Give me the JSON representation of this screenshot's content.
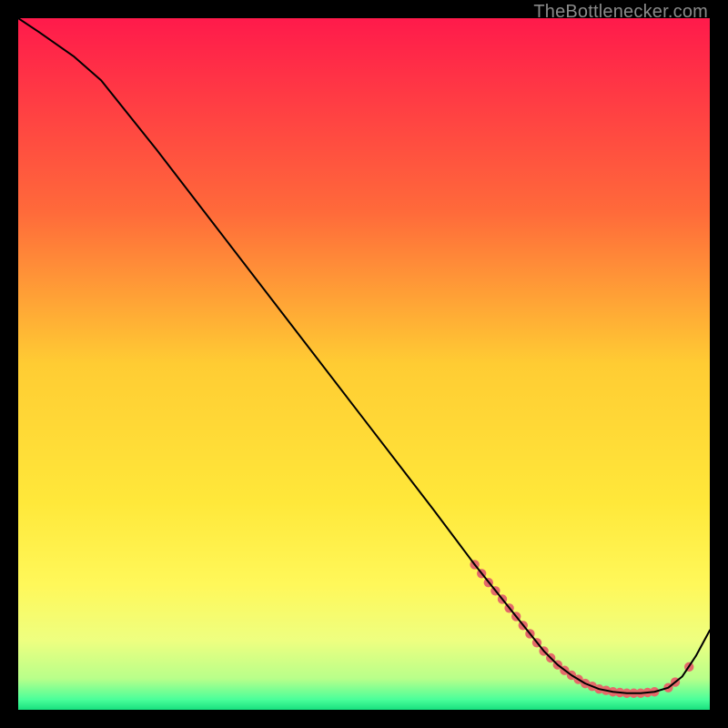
{
  "watermark": "TheBottlenecker.com",
  "chart_data": {
    "type": "line",
    "title": "",
    "xlabel": "",
    "ylabel": "",
    "xlim": [
      0,
      100
    ],
    "ylim": [
      0,
      100
    ],
    "background_gradient": {
      "stops": [
        {
          "offset": 0,
          "color": "#ff1a4b"
        },
        {
          "offset": 0.28,
          "color": "#ff6a3a"
        },
        {
          "offset": 0.5,
          "color": "#ffcc33"
        },
        {
          "offset": 0.7,
          "color": "#ffe83a"
        },
        {
          "offset": 0.82,
          "color": "#fff85a"
        },
        {
          "offset": 0.9,
          "color": "#eeff80"
        },
        {
          "offset": 0.955,
          "color": "#b8ff8a"
        },
        {
          "offset": 0.985,
          "color": "#4bff9a"
        },
        {
          "offset": 1.0,
          "color": "#18e07e"
        }
      ]
    },
    "series": [
      {
        "name": "bottleneck-curve",
        "color": "#000000",
        "stroke_width": 2,
        "x": [
          0,
          3,
          8,
          12,
          20,
          30,
          40,
          50,
          60,
          66,
          70,
          72,
          74,
          76,
          78,
          80,
          82,
          84,
          86,
          88,
          90,
          92,
          94,
          96,
          98,
          100
        ],
        "y": [
          100,
          98,
          94.5,
          91,
          81,
          68,
          55,
          42,
          29,
          21,
          16,
          13.5,
          11,
          8.5,
          6.5,
          5,
          3.8,
          3,
          2.6,
          2.4,
          2.4,
          2.6,
          3.2,
          4.8,
          7.8,
          11.5
        ]
      }
    ],
    "markers": {
      "name": "highlight-dots",
      "color": "#e46a6a",
      "radius": 5.2,
      "x": [
        66,
        67,
        68,
        69,
        70,
        71,
        72,
        73,
        74,
        75,
        76,
        77,
        78,
        79,
        80,
        81,
        82,
        83,
        84,
        85,
        86,
        87,
        88,
        89,
        90,
        91,
        92,
        94,
        95,
        97
      ],
      "y": [
        21,
        19.7,
        18.4,
        17.2,
        16,
        14.7,
        13.5,
        12.2,
        11,
        9.7,
        8.5,
        7.5,
        6.5,
        5.7,
        5,
        4.4,
        3.8,
        3.4,
        3,
        2.8,
        2.6,
        2.5,
        2.4,
        2.4,
        2.4,
        2.5,
        2.6,
        3.2,
        4,
        6.2
      ]
    }
  }
}
